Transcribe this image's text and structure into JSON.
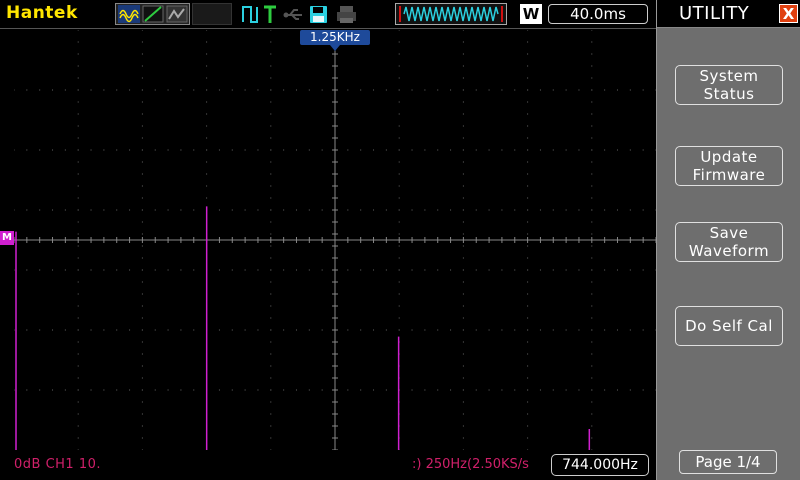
{
  "header": {
    "brand": "Hantek",
    "timebase": "40.0ms",
    "acq_badge": "W"
  },
  "screen": {
    "freq_marker": "1.25KHz",
    "channel_marker": "M",
    "grid": {
      "cols": 10,
      "rows": 7
    },
    "trace_color": "#d020d0",
    "spikes": [
      {
        "pos": 0.0,
        "level": 0.52
      },
      {
        "pos": 0.297,
        "level": 0.58
      },
      {
        "pos": 0.596,
        "level": 0.27
      },
      {
        "pos": 0.893,
        "level": 0.05
      }
    ]
  },
  "status": {
    "channel": "0dB CH1 10.",
    "sample": ":) 250Hz(2.50KS/s",
    "frequency": "744.000Hz"
  },
  "menu": {
    "title": "UTILITY",
    "close": "X",
    "buttons": [
      {
        "label": "System\nStatus"
      },
      {
        "label": "Update\nFirmware"
      },
      {
        "label": "Save\nWaveform"
      },
      {
        "label": "Do Self Cal"
      }
    ],
    "page": "Page 1/4"
  },
  "colors": {
    "brand": "#ffe600",
    "status_text": "#d0206a",
    "accent": "#1e4a9a",
    "menu_bg": "#6e6e6e"
  }
}
